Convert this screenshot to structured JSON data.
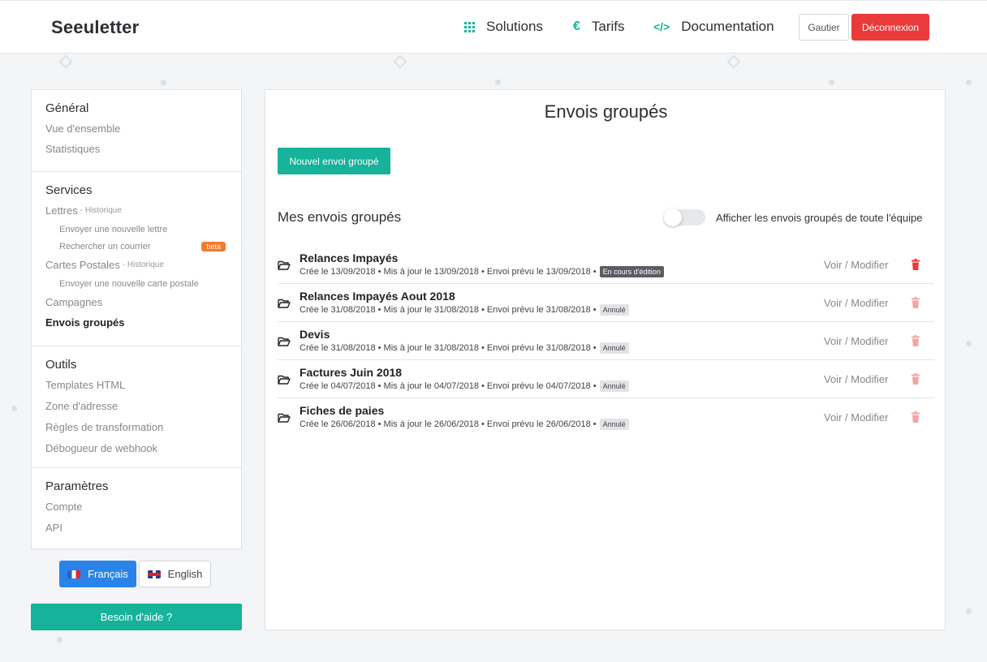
{
  "header": {
    "brand": "Seeuletter",
    "nav": [
      {
        "label": "Solutions",
        "icon": "grid-icon"
      },
      {
        "label": "Tarifs",
        "icon": "euro-icon"
      },
      {
        "label": "Documentation",
        "icon": "code-icon"
      }
    ],
    "user_button": "Gautier",
    "logout_button": "Déconnexion"
  },
  "sidebar": {
    "general": {
      "title": "Général",
      "links": [
        "Vue d'ensemble",
        "Statistiques"
      ]
    },
    "services": {
      "title": "Services",
      "letters": {
        "label": "Lettres",
        "sub": "- Historique"
      },
      "letters_sub": [
        "Envoyer une nouvelle lettre",
        "Rechercher un courrier"
      ],
      "beta_badge": "beta",
      "postcards": {
        "label": "Cartes Postales",
        "sub": "- Historique"
      },
      "postcards_sub": [
        "Envoyer une nouvelle carte postale"
      ],
      "campaigns": "Campagnes",
      "bulk": "Envois groupés"
    },
    "tools": {
      "title": "Outils",
      "links": [
        "Templates HTML",
        "Zone d'adresse",
        "Règles de transformation",
        "Débogueur de webhook"
      ]
    },
    "settings": {
      "title": "Paramètres",
      "links": [
        "Compte",
        "API"
      ]
    }
  },
  "language": {
    "fr": "Français",
    "en": "English"
  },
  "help_button": "Besoin d'aide ?",
  "main": {
    "title": "Envois groupés",
    "new_button": "Nouvel envoi groupé",
    "list_title": "Mes envois groupés",
    "toggle_label": "Afficher les envois groupés de toute l'équipe",
    "action_label": "Voir / Modifier",
    "rows": [
      {
        "name": "Relances Impayés",
        "meta": "Crée le 13/09/2018 • Mis à jour le 13/09/2018 • Envoi prévu le 13/09/2018 •",
        "status": "En cours d'édition",
        "status_type": "editing"
      },
      {
        "name": "Relances Impayés Aout 2018",
        "meta": "Crée le 31/08/2018 • Mis à jour le 31/08/2018 • Envoi prévu le 31/08/2018 •",
        "status": "Annulé",
        "status_type": "cancelled"
      },
      {
        "name": "Devis",
        "meta": "Crée le 31/08/2018 • Mis à jour le 31/08/2018 • Envoi prévu le 31/08/2018 •",
        "status": "Annulé",
        "status_type": "cancelled"
      },
      {
        "name": "Factures Juin 2018",
        "meta": "Crée le 04/07/2018 • Mis à jour le 04/07/2018 • Envoi prévu le 04/07/2018 •",
        "status": "Annulé",
        "status_type": "cancelled"
      },
      {
        "name": "Fiches de paies",
        "meta": "Crée le 26/06/2018 • Mis à jour le 26/06/2018 • Envoi prévu le 26/06/2018 •",
        "status": "Annulé",
        "status_type": "cancelled"
      }
    ]
  },
  "colors": {
    "accent": "#16b29a",
    "danger": "#ea3a3a",
    "primary": "#2a83e8",
    "beta": "#f07c2b"
  }
}
